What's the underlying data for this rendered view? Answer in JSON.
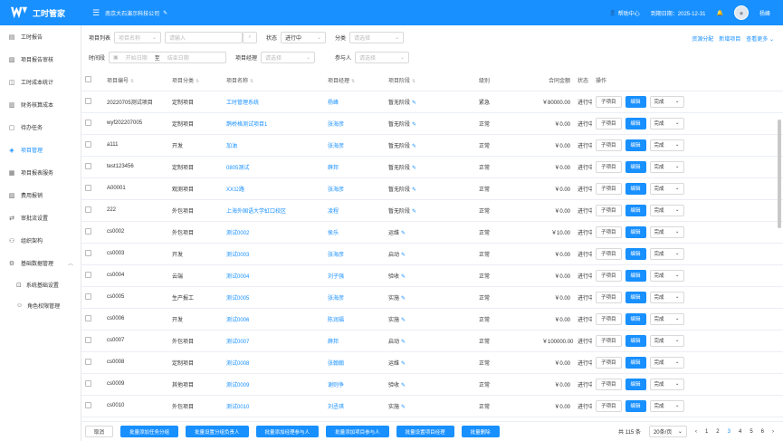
{
  "app": {
    "title": "工时管家",
    "company": "南京大石演示科技公司",
    "help": "帮助中心",
    "expire": "到期日期：2025-12-31",
    "user": "杨峰"
  },
  "colors": {
    "primary": "#1890ff"
  },
  "sidebar": {
    "items": [
      {
        "label": "工时报告",
        "icon": "report-icon"
      },
      {
        "label": "项目报告审核",
        "icon": "audit-icon"
      },
      {
        "label": "工时成本统计",
        "icon": "stats-icon"
      },
      {
        "label": "财务核算成本",
        "icon": "finance-icon"
      },
      {
        "label": "待办任务",
        "icon": "todo-icon"
      },
      {
        "label": "项目管理",
        "icon": "project-icon"
      },
      {
        "label": "项目报表服务",
        "icon": "report-service-icon"
      },
      {
        "label": "费用报销",
        "icon": "expense-icon"
      },
      {
        "label": "审批流设置",
        "icon": "approval-icon"
      },
      {
        "label": "组织架构",
        "icon": "org-icon"
      },
      {
        "label": "基础数据管理",
        "icon": "data-icon"
      }
    ],
    "subitems": [
      {
        "label": "系统基础设置",
        "icon": "settings-icon"
      },
      {
        "label": "角色权限管理",
        "icon": "role-icon"
      }
    ]
  },
  "filters": {
    "project_list_label": "项目列表",
    "project_name": "项目名称",
    "input_placeholder": "请输入",
    "status_label": "状态",
    "status_value": "进行中",
    "category_label": "分类",
    "choose_placeholder": "请选择",
    "time_label": "时间段",
    "start_date": "开始日期",
    "date_sep": "至",
    "end_date": "结束日期",
    "manager_label": "项目经理",
    "participant_label": "参与人"
  },
  "links": {
    "resource": "资源分配",
    "add": "新增项目",
    "more": "查看更多"
  },
  "table": {
    "headers": [
      "项目编号",
      "项目分类",
      "项目名称",
      "项目经理",
      "项目阶段",
      "级别",
      "合同金额",
      "状态",
      "操作"
    ],
    "op_labels": {
      "sub": "子项目",
      "edit": "编辑",
      "done": "完成"
    },
    "rows": [
      {
        "code": "20220705测试项目",
        "cat": "定制项目",
        "name": "工时管理系统",
        "mgr": "杨峰",
        "stage": "暂无阶段",
        "level": "紧急",
        "amount": "￥80000.00",
        "status": "进行中"
      },
      {
        "code": "wyf202207005",
        "cat": "定制项目",
        "name": "鹊桥格测试项目1",
        "mgr": "张海彦",
        "stage": "暂无阶段",
        "level": "正常",
        "amount": "￥0.00",
        "status": "进行中"
      },
      {
        "code": "a111",
        "cat": "开发",
        "name": "加油",
        "mgr": "张海彦",
        "stage": "暂无阶段",
        "level": "正常",
        "amount": "￥0.00",
        "status": "进行中"
      },
      {
        "code": "test123456",
        "cat": "定制项目",
        "name": "0805测试",
        "mgr": "薛邦",
        "stage": "暂无阶段",
        "level": "正常",
        "amount": "￥0.00",
        "status": "进行中"
      },
      {
        "code": "A00001",
        "cat": "观测项目",
        "name": "XX公路",
        "mgr": "张海彦",
        "stage": "暂无阶段",
        "level": "正常",
        "amount": "￥0.00",
        "status": "进行中"
      },
      {
        "code": "222",
        "cat": "外包项目",
        "name": "上海外国语大学虹口校区",
        "mgr": "凌程",
        "stage": "暂无阶段",
        "level": "正常",
        "amount": "￥0.00",
        "status": "进行中"
      },
      {
        "code": "cs0002",
        "cat": "外包项目",
        "name": "测试0002",
        "mgr": "侯乐",
        "stage": "运维",
        "level": "正常",
        "amount": "￥10.00",
        "status": "进行中"
      },
      {
        "code": "cs0003",
        "cat": "开发",
        "name": "测试0003",
        "mgr": "张海彦",
        "stage": "启动",
        "level": "正常",
        "amount": "￥0.00",
        "status": "进行中"
      },
      {
        "code": "cs0004",
        "cat": "云端",
        "name": "测试0004",
        "mgr": "刘子强",
        "stage": "验收",
        "level": "正常",
        "amount": "￥0.00",
        "status": "进行中"
      },
      {
        "code": "cs0005",
        "cat": "生产报工",
        "name": "测试0005",
        "mgr": "张海彦",
        "stage": "实施",
        "level": "正常",
        "amount": "￥0.00",
        "status": "进行中"
      },
      {
        "code": "cs0006",
        "cat": "开发",
        "name": "测试0006",
        "mgr": "陈润福",
        "stage": "实施",
        "level": "正常",
        "amount": "￥0.00",
        "status": "进行中"
      },
      {
        "code": "cs0007",
        "cat": "外包项目",
        "name": "测试0007",
        "mgr": "薛邦",
        "stage": "启动",
        "level": "正常",
        "amount": "￥100000.00",
        "status": "进行中"
      },
      {
        "code": "cs0008",
        "cat": "定制项目",
        "name": "测试0008",
        "mgr": "张翰翰",
        "stage": "运维",
        "level": "正常",
        "amount": "￥0.00",
        "status": "进行中"
      },
      {
        "code": "cs0009",
        "cat": "其他项目",
        "name": "测试0009",
        "mgr": "谢则争",
        "stage": "验收",
        "level": "正常",
        "amount": "￥0.00",
        "status": "进行中"
      },
      {
        "code": "cs0010",
        "cat": "外包项目",
        "name": "测试0010",
        "mgr": "刘丞琪",
        "stage": "实施",
        "level": "正常",
        "amount": "￥0.00",
        "status": "进行中"
      }
    ]
  },
  "bottom": {
    "cancel": "取消",
    "buttons": [
      "批量添加任务分组",
      "批量设置分组负责人",
      "批量添加经理参与人",
      "批量添加项目参与人",
      "批量设置项目经理",
      "批量删除"
    ]
  },
  "pagination": {
    "total": "共 115 条",
    "page_size": "20条/页",
    "prev": "‹",
    "next": "›",
    "pages": [
      "1",
      "2",
      "3",
      "4",
      "5",
      "6"
    ],
    "current": "3"
  }
}
